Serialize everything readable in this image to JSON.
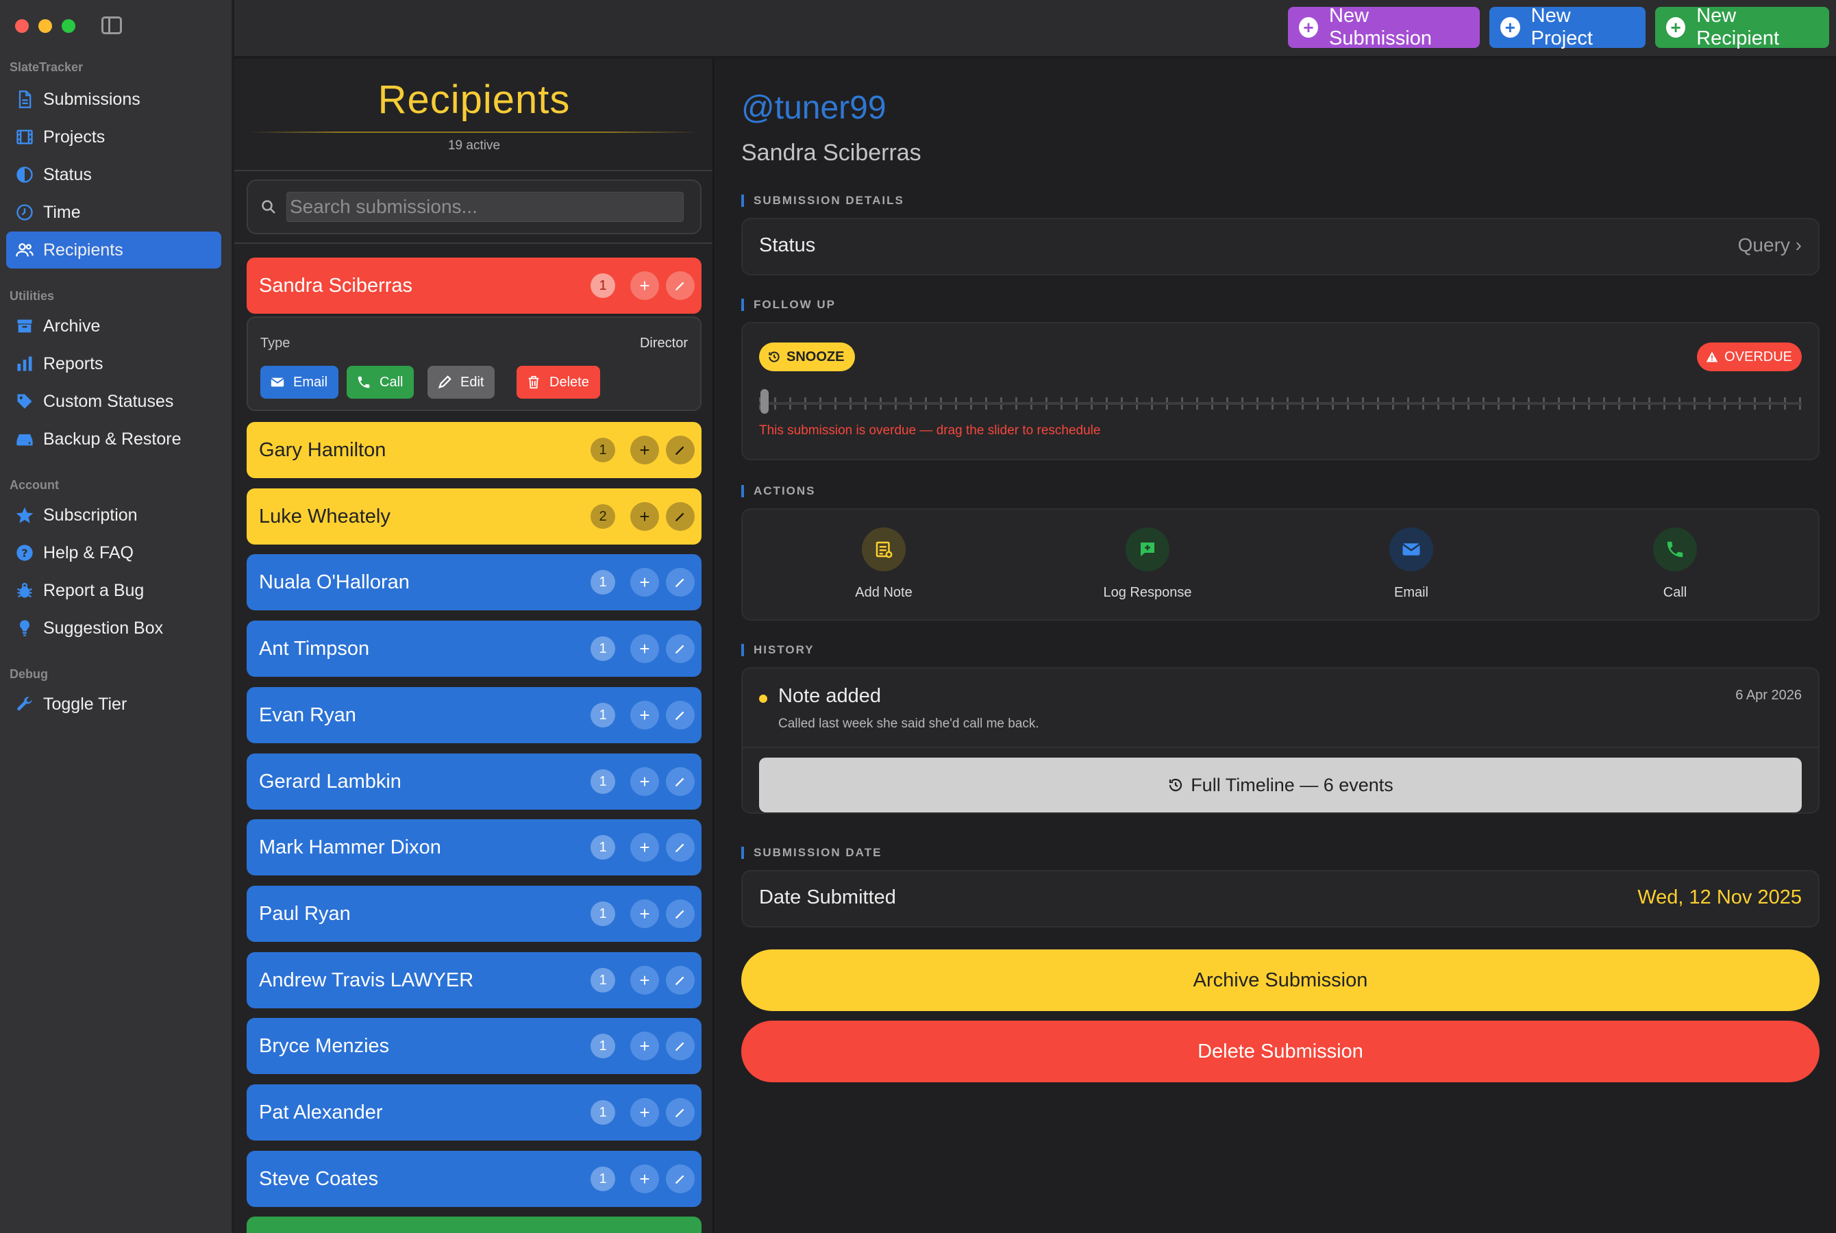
{
  "sidebar": {
    "app_section": "SlateTracker",
    "main_items": [
      {
        "label": "Submissions",
        "icon": "document-icon"
      },
      {
        "label": "Projects",
        "icon": "film-icon"
      },
      {
        "label": "Status",
        "icon": "half-circle-icon"
      },
      {
        "label": "Time",
        "icon": "clock-icon"
      },
      {
        "label": "Recipients",
        "icon": "people-icon",
        "active": true
      }
    ],
    "utilities_section": "Utilities",
    "utility_items": [
      {
        "label": "Archive",
        "icon": "archive-box-icon"
      },
      {
        "label": "Reports",
        "icon": "bar-chart-icon"
      },
      {
        "label": "Custom Statuses",
        "icon": "tag-icon"
      },
      {
        "label": "Backup & Restore",
        "icon": "drive-icon"
      }
    ],
    "account_section": "Account",
    "account_items": [
      {
        "label": "Subscription",
        "icon": "star-icon"
      },
      {
        "label": "Help & FAQ",
        "icon": "question-icon"
      },
      {
        "label": "Report a Bug",
        "icon": "bug-icon"
      },
      {
        "label": "Suggestion Box",
        "icon": "lightbulb-icon"
      }
    ],
    "debug_section": "Debug",
    "debug_items": [
      {
        "label": "Toggle Tier",
        "icon": "wrench-icon"
      }
    ]
  },
  "toolbar": {
    "new_submission": "New Submission",
    "new_project": "New Project",
    "new_recipient": "New Recipient"
  },
  "list": {
    "title": "Recipients",
    "subtitle": "19 active",
    "search_placeholder": "Search submissions...",
    "recipients": [
      {
        "name": "Sandra Sciberras",
        "count": "1",
        "color": "red"
      },
      {
        "name": "Gary Hamilton",
        "count": "1",
        "color": "yellow"
      },
      {
        "name": "Luke Wheately",
        "count": "2",
        "color": "yellow"
      },
      {
        "name": "Nuala O'Halloran",
        "count": "1",
        "color": "blue"
      },
      {
        "name": "Ant Timpson",
        "count": "1",
        "color": "blue"
      },
      {
        "name": "Evan Ryan",
        "count": "1",
        "color": "blue"
      },
      {
        "name": "Gerard Lambkin",
        "count": "1",
        "color": "blue"
      },
      {
        "name": "Mark Hammer Dixon",
        "count": "1",
        "color": "blue"
      },
      {
        "name": "Paul Ryan",
        "count": "1",
        "color": "blue"
      },
      {
        "name": "Andrew Travis LAWYER",
        "count": "1",
        "color": "blue"
      },
      {
        "name": "Bryce Menzies",
        "count": "1",
        "color": "blue"
      },
      {
        "name": "Pat Alexander",
        "count": "1",
        "color": "blue"
      },
      {
        "name": "Steve Coates",
        "count": "1",
        "color": "blue"
      }
    ],
    "expanded": {
      "type_label": "Type",
      "type_value": "Director",
      "email": "Email",
      "call": "Call",
      "edit": "Edit",
      "delete": "Delete"
    }
  },
  "detail": {
    "handle": "@tuner99",
    "name": "Sandra Sciberras",
    "sections": {
      "details": "SUBMISSION DETAILS",
      "follow_up": "FOLLOW UP",
      "actions": "ACTIONS",
      "history": "HISTORY",
      "date": "SUBMISSION DATE"
    },
    "status_label": "Status",
    "status_value": "Query ›",
    "snooze": "SNOOZE",
    "overdue": "OVERDUE",
    "overdue_message": "This submission is overdue — drag the slider to reschedule",
    "actions": {
      "add_note": "Add Note",
      "log_response": "Log Response",
      "email": "Email",
      "call": "Call"
    },
    "history": {
      "title": "Note added",
      "date": "6 Apr 2026",
      "text": "Called last week she said she'd call me back.",
      "timeline_button": "Full Timeline — 6 events"
    },
    "date_label": "Date Submitted",
    "date_value": "Wed, 12 Nov 2025",
    "archive_button": "Archive Submission",
    "delete_button": "Delete Submission"
  },
  "colors": {
    "accent_blue": "#2b72d6",
    "red": "#f5473b",
    "yellow": "#fdd030",
    "green": "#2f9f4a",
    "purple": "#a44fd3"
  }
}
